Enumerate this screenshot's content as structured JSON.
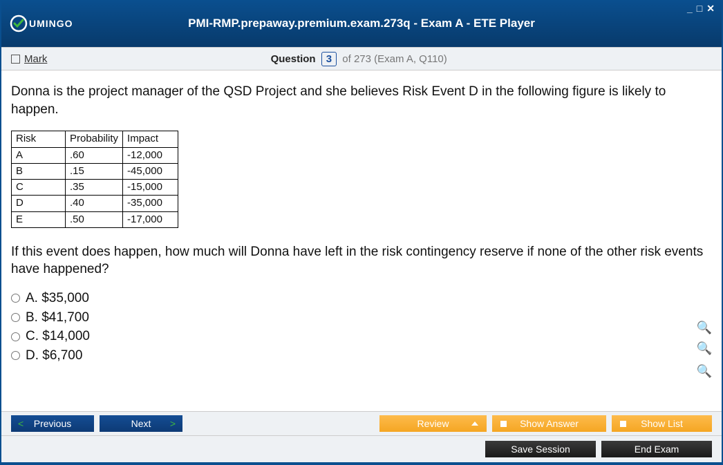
{
  "window": {
    "title": "PMI-RMP.prepaway.premium.exam.273q - Exam A - ETE Player"
  },
  "logo": {
    "text": "UMINGO"
  },
  "mark": {
    "label": "Mark"
  },
  "question": {
    "label": "Question",
    "number": "3",
    "rest": " of 273 (Exam A, Q110)",
    "prompt": "Donna is the project manager of the QSD Project and she believes Risk Event D in the following figure is likely to happen.",
    "followup": "If this event does happen, how much will Donna have left in the risk contingency reserve if none of the other risk events have happened?"
  },
  "table": {
    "headers": [
      "Risk",
      "Probability",
      "Impact"
    ],
    "rows": [
      [
        "A",
        ".60",
        "-12,000"
      ],
      [
        "B",
        ".15",
        "-45,000"
      ],
      [
        "C",
        ".35",
        "-15,000"
      ],
      [
        "D",
        ".40",
        "-35,000"
      ],
      [
        "E",
        ".50",
        "-17,000"
      ]
    ]
  },
  "options": [
    {
      "label": "A. $35,000"
    },
    {
      "label": "B. $41,700"
    },
    {
      "label": "C. $14,000"
    },
    {
      "label": "D. $6,700"
    }
  ],
  "buttons": {
    "previous": "Previous",
    "next": "Next",
    "review": "Review",
    "show_answer": "Show Answer",
    "show_list": "Show List",
    "save_session": "Save Session",
    "end_exam": "End Exam"
  }
}
